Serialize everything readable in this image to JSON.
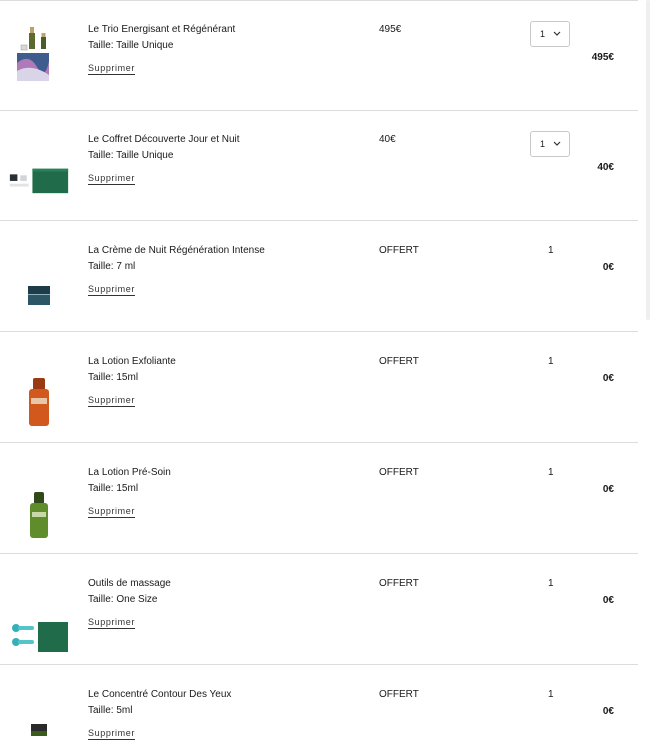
{
  "cart": {
    "remove_label": "Supprimer",
    "size_prefix": "Taille: ",
    "items": [
      {
        "name": "Le Trio Energisant et Régénérant",
        "size": "Taille Unique",
        "unit_price": "495€",
        "quantity": "1",
        "quantity_editable": true,
        "total": "495€",
        "image_icon": "trio-set-icon"
      },
      {
        "name": "Le Coffret Découverte Jour et Nuit",
        "size": "Taille Unique",
        "unit_price": "40€",
        "quantity": "1",
        "quantity_editable": true,
        "total": "40€",
        "image_icon": "discovery-box-icon"
      },
      {
        "name": "La Crème de Nuit Régénération Intense",
        "size": "7 ml",
        "unit_price": "OFFERT",
        "quantity": "1",
        "quantity_editable": false,
        "total": "0€",
        "image_icon": "cream-jar-icon"
      },
      {
        "name": "La Lotion Exfoliante",
        "size": "15ml",
        "unit_price": "OFFERT",
        "quantity": "1",
        "quantity_editable": false,
        "total": "0€",
        "image_icon": "orange-bottle-icon"
      },
      {
        "name": "La Lotion Pré-Soin",
        "size": "15ml",
        "unit_price": "OFFERT",
        "quantity": "1",
        "quantity_editable": false,
        "total": "0€",
        "image_icon": "green-bottle-icon"
      },
      {
        "name": "Outils de massage",
        "size": "One Size",
        "unit_price": "OFFERT",
        "quantity": "1",
        "quantity_editable": false,
        "total": "0€",
        "image_icon": "massage-tools-icon"
      },
      {
        "name": "Le Concentré Contour Des Yeux",
        "size": "5ml",
        "unit_price": "OFFERT",
        "quantity": "1",
        "quantity_editable": false,
        "total": "0€",
        "image_icon": "eye-concentrate-jar-icon"
      }
    ]
  },
  "colors": {
    "divider": "#dcdcdc",
    "brand_green": "#1f6b4a",
    "text": "#1a1a1a"
  }
}
